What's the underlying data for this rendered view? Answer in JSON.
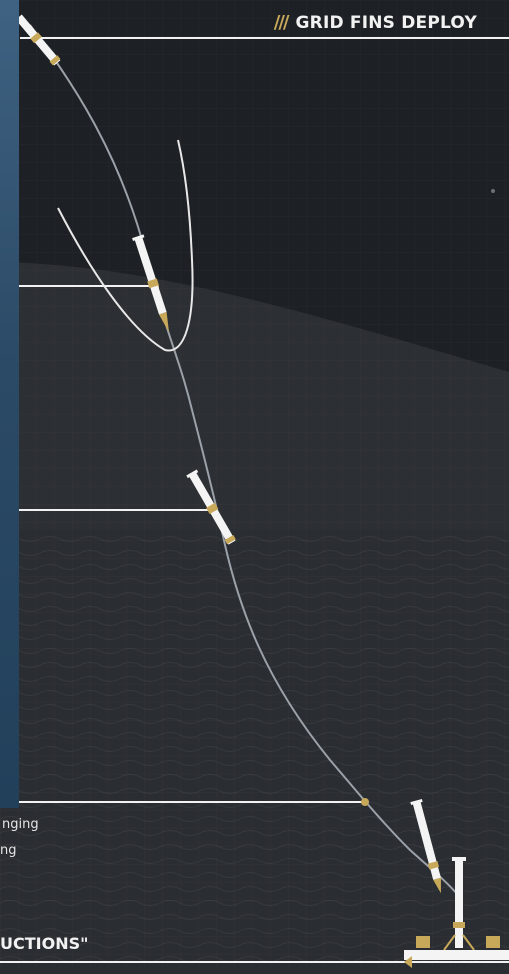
{
  "phase_label": "GRID FINS DEPLOY",
  "phase_marker": "///",
  "side_text_1": "nging",
  "side_text_2": "ng",
  "bottom_label": "UCTIONS\"",
  "colors": {
    "background": "#2a2d31",
    "sky": "#1d2024",
    "accent_gold": "#c8a95a",
    "rocket_white": "#f4f4f4",
    "trajectory": "#9aa1a8",
    "sidebar_blue": "#2f5170"
  },
  "icons": [
    "rocket-icon",
    "landing-pad-icon",
    "flame-icon",
    "checkpoint-dot-icon"
  ]
}
